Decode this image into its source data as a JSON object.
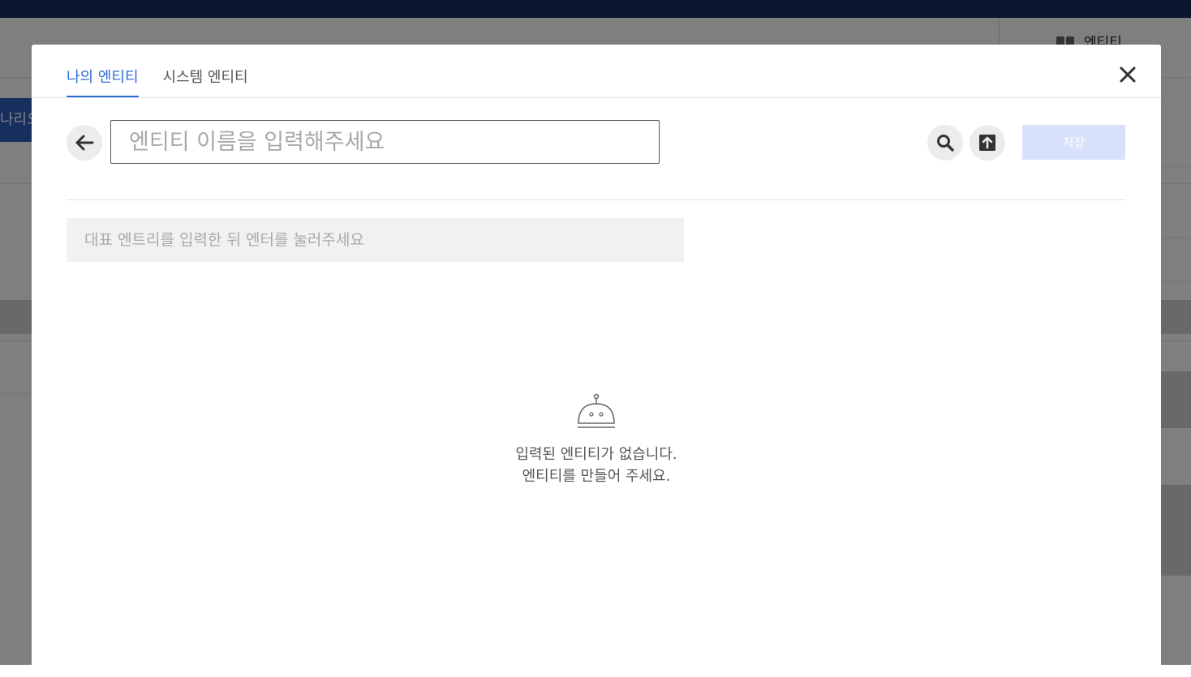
{
  "background": {
    "entity_menu_label": "엔티티",
    "left_button_label": "나리오"
  },
  "modal": {
    "tabs": [
      {
        "label": "나의 엔티티",
        "active": true
      },
      {
        "label": "시스템 엔티티",
        "active": false
      }
    ],
    "close_icon": "close-icon",
    "toolbar": {
      "back_icon": "arrow-left-icon",
      "name_input": {
        "value": "",
        "placeholder": "엔티티 이름을 입력해주세요"
      },
      "search_icon": "search-icon",
      "upload_icon": "upload-icon",
      "save_label": "저장"
    },
    "entry_input": {
      "value": "",
      "placeholder": "대표 엔트리를 입력한 뒤 엔터를 눌러주세요"
    },
    "empty_state": {
      "icon": "robot-icon",
      "line1": "입력된 엔티티가 없습니다.",
      "line2": "엔티티를 만들어 주세요."
    }
  },
  "colors": {
    "accent": "#2b6bd6",
    "save_disabled": "#d7e1fb",
    "topbar": "#0c1530"
  }
}
